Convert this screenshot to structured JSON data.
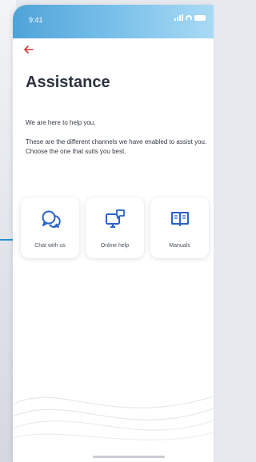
{
  "status_bar": {
    "time": "9:41",
    "icons": [
      "signal-icon",
      "wifi-icon",
      "battery-icon"
    ]
  },
  "header": {
    "back_icon": "back-arrow-icon",
    "title": "Assistance"
  },
  "intro": {
    "line1": "We are here to help you.",
    "line2": "These are the different channels we have enabled to assist you. Choose the one that suits you best."
  },
  "channels": [
    {
      "label": "Chat with us",
      "icon": "chat-bubbles-icon"
    },
    {
      "label": "Online help",
      "icon": "monitor-chat-icon"
    },
    {
      "label": "Manuals",
      "icon": "open-book-icon"
    }
  ],
  "colors": {
    "accent_blue": "#2a63c9",
    "back_red": "#d33a3a",
    "title": "#2b3340",
    "status_gradient_start": "#4fa3d8",
    "status_gradient_end": "#a9daf5"
  }
}
